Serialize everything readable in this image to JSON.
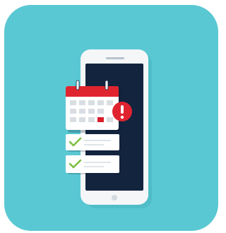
{
  "illustration": {
    "subject": "mobile-calendar-alert",
    "alert_glyph": "!",
    "checklist": [
      {
        "checked": true
      },
      {
        "checked": true
      }
    ],
    "colors": {
      "background": "#5ac8d3",
      "phone_body": "#f4f6f8",
      "phone_screen": "#13243f",
      "calendar_header": "#e0242f",
      "calendar_body": "#ffffff",
      "alert_badge": "#e0242f",
      "check_green": "#7bc043",
      "highlight_cell": "#d81e2a",
      "grey_cell": "#d9dee3",
      "shadow": "#2e8f9a"
    }
  }
}
